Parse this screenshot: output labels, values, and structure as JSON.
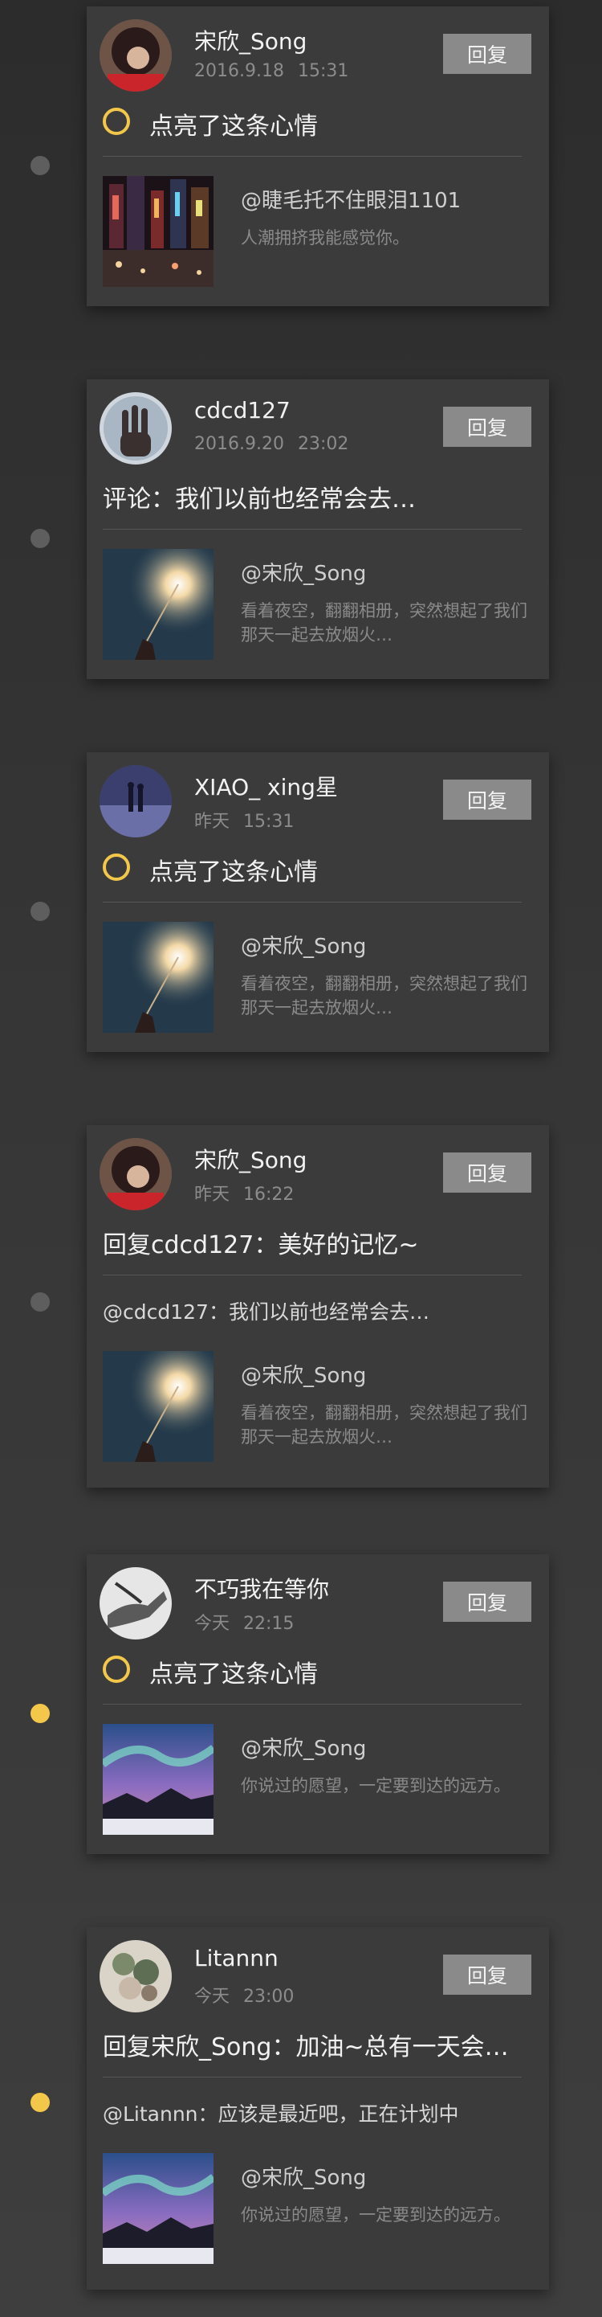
{
  "reply_label": "回复",
  "colors": {
    "accent": "#f3c74a",
    "card": "#3b3b3b",
    "button": "#8a8a8a"
  },
  "cards": [
    {
      "username": "宋欣_Song",
      "timestamp": "2016.9.18    15:31",
      "type": "like",
      "action_text": "点亮了这条心情",
      "ref_author": "@睫毛托不住眼泪1101",
      "ref_desc": "人潮拥挤我能感觉你。",
      "avatar": "girl-red-avatar",
      "thumb": "city-night-image"
    },
    {
      "username": "cdcd127",
      "timestamp": "2016.9.20    23:02",
      "type": "comment",
      "action_text": "评论：我们以前也经常会去…",
      "ref_author": "@宋欣_Song",
      "ref_desc": "看着夜空，翻翻相册，突然想起了我们那天一起去放烟火…",
      "avatar": "hand-avatar",
      "thumb": "sparkler-image"
    },
    {
      "username": "XIAO_ xing星",
      "timestamp": "昨天    15:31",
      "type": "like",
      "action_text": "点亮了这条心情",
      "ref_author": "@宋欣_Song",
      "ref_desc": "看着夜空，翻翻相册，突然想起了我们那天一起去放烟火…",
      "avatar": "couple-avatar",
      "thumb": "sparkler-image"
    },
    {
      "username": "宋欣_Song",
      "timestamp": "昨天    16:22",
      "type": "reply",
      "action_text": "回复cdcd127：美好的记忆~",
      "quote": "@cdcd127：我们以前也经常会去…",
      "ref_author": "@宋欣_Song",
      "ref_desc": "看着夜空，翻翻相册，突然想起了我们那天一起去放烟火…",
      "avatar": "girl-red-avatar",
      "thumb": "sparkler-image"
    },
    {
      "username": "不巧我在等你",
      "timestamp": "今天    22:15",
      "type": "like",
      "action_text": "点亮了这条心情",
      "ref_author": "@宋欣_Song",
      "ref_desc": "你说过的愿望，一定要到达的远方。",
      "avatar": "hands-bw-avatar",
      "thumb": "aurora-image"
    },
    {
      "username": "Litannn",
      "timestamp": "今天    23:00",
      "type": "reply",
      "action_text": "回复宋欣_Song：加油~总有一天会…",
      "quote": "@Litannn：应该是最近吧，正在计划中",
      "ref_author": "@宋欣_Song",
      "ref_desc": "你说过的愿望，一定要到达的远方。",
      "avatar": "flowers-avatar",
      "thumb": "aurora-image"
    }
  ]
}
